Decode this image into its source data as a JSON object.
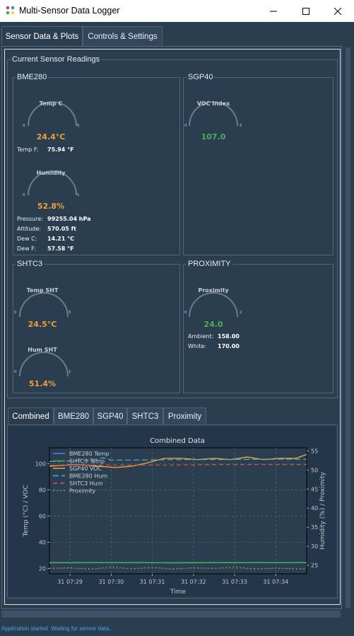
{
  "window": {
    "title": "Multi-Sensor Data Logger"
  },
  "main_tabs": [
    {
      "label": "Sensor Data & Plots",
      "active": true
    },
    {
      "label": "Controls & Settings",
      "active": false
    }
  ],
  "readings": {
    "group_title": "Current Sensor Readings",
    "bme280": {
      "title": "BME280",
      "temp_gauge": {
        "title": "Temp C",
        "min_label": "0",
        "max_label": "5",
        "value": "24.4°C"
      },
      "temp_f": {
        "label": "Temp F:",
        "value": "75.94 °F"
      },
      "hum_gauge": {
        "title": "Humidity",
        "min_label": "0",
        "max_label": "1",
        "value": "52.8%"
      },
      "pressure": {
        "label": "Pressure:",
        "value": "99255.04 hPa"
      },
      "altitude": {
        "label": "Altitude:",
        "value": "570.05 ft"
      },
      "dew_c": {
        "label": "Dew C:",
        "value": "14.21 °C"
      },
      "dew_f": {
        "label": "Dew F:",
        "value": "57.58 °F"
      }
    },
    "sgp40": {
      "title": "SGP40",
      "voc_gauge": {
        "title": "VOC Index",
        "min_label": "0",
        "max_label": "5",
        "value": "107.0"
      }
    },
    "shtc3": {
      "title": "SHTC3",
      "temp_gauge": {
        "title": "Temp SHT",
        "min_label": "0",
        "max_label": "5",
        "value": "24.5°C"
      },
      "hum_gauge": {
        "title": "Hum SHT",
        "min_label": "0",
        "max_label": "1",
        "value": "51.4%"
      }
    },
    "proximity": {
      "title": "PROXIMITY",
      "prox_gauge": {
        "title": "Proximity",
        "min_label": "0",
        "max_label": "2",
        "value": "24.0"
      },
      "ambient": {
        "label": "Ambient:",
        "value": "158.00"
      },
      "white": {
        "label": "White:",
        "value": "170.00"
      }
    }
  },
  "plot_tabs": [
    {
      "label": "Combined",
      "active": true
    },
    {
      "label": "BME280",
      "active": false
    },
    {
      "label": "SGP40",
      "active": false
    },
    {
      "label": "SHTC3",
      "active": false
    },
    {
      "label": "Proximity",
      "active": false
    }
  ],
  "status": {
    "text": "Application started. Waiting for sensor data..."
  },
  "colors": {
    "orange": "#f0a030",
    "green": "#4caf50",
    "blue": "#3a8fd8",
    "cyan": "#40b8d8",
    "red": "#e05050",
    "olive": "#8a9a5b"
  },
  "chart_data": {
    "type": "line",
    "title": "Combined Data",
    "xlabel": "Time",
    "ylabel": "Temp (°C) / VOC",
    "ylabel_right": "Humidity (%) / Proximity",
    "x_ticks": [
      "31 07:29",
      "31 07:30",
      "31 07:31",
      "31 07:32",
      "31 07:33",
      "31 07:34"
    ],
    "y_ticks_left": [
      20,
      40,
      60,
      80,
      100
    ],
    "y_ticks_right": [
      25,
      30,
      35,
      40,
      45,
      50,
      55
    ],
    "ylim_left": [
      16,
      112
    ],
    "ylim_right": [
      22.8,
      55.8
    ],
    "xlim": [
      0,
      6.25
    ],
    "grid": true,
    "legend_position": "top-left",
    "series": [
      {
        "name": "BME280 Temp",
        "axis": "left",
        "color": "#3a8fd8",
        "dash": "solid",
        "x": [
          0,
          1,
          2,
          3,
          4,
          5,
          6.25
        ],
        "y": [
          24.3,
          24.4,
          24.4,
          24.3,
          24.4,
          24.4,
          24.4
        ]
      },
      {
        "name": "SHTC3 Temp",
        "axis": "left",
        "color": "#4caf50",
        "dash": "solid",
        "x": [
          0,
          1,
          2,
          3,
          4,
          5,
          6.25
        ],
        "y": [
          24.5,
          24.5,
          24.5,
          24.4,
          24.5,
          24.5,
          24.5
        ]
      },
      {
        "name": "SGP40 VOC",
        "axis": "left",
        "color": "#f0a030",
        "dash": "solid",
        "x": [
          0,
          0.5,
          0.8,
          1.2,
          1.6,
          2.0,
          2.3,
          2.8,
          3.2,
          3.6,
          4.0,
          4.4,
          4.8,
          5.2,
          5.6,
          6.0,
          6.25
        ],
        "y": [
          98,
          99,
          99,
          98,
          97,
          98,
          100,
          104,
          104,
          103,
          104,
          103,
          105,
          103,
          104,
          104,
          107
        ]
      },
      {
        "name": "BME280 Hum",
        "axis": "right",
        "color": "#40b8d8",
        "dash": "8,4",
        "x": [
          0,
          1,
          1.3,
          1.5,
          2,
          3,
          4,
          5,
          6,
          6.25
        ],
        "y": [
          52.2,
          52.5,
          53.2,
          52.6,
          52.6,
          52.7,
          52.7,
          52.8,
          52.8,
          52.8
        ]
      },
      {
        "name": "SHTC3 Hum",
        "axis": "right",
        "color": "#e05050",
        "dash": "6,4",
        "x": [
          0,
          1,
          2,
          3,
          4,
          5,
          6,
          6.25
        ],
        "y": [
          51.2,
          51.3,
          51.3,
          51.3,
          51.4,
          51.4,
          51.4,
          51.4
        ]
      },
      {
        "name": "Proximity",
        "axis": "right",
        "color": "#8a9a5b",
        "dash": "2,3",
        "x": [
          0,
          0.5,
          1,
          1.5,
          2,
          2.5,
          3,
          3.5,
          4,
          4.5,
          5,
          5.5,
          6,
          6.25
        ],
        "y": [
          24.2,
          24.4,
          24.0,
          24.6,
          24.1,
          24.5,
          24.0,
          24.4,
          24.2,
          24.6,
          24.0,
          24.3,
          24.1,
          24.0
        ]
      }
    ]
  }
}
